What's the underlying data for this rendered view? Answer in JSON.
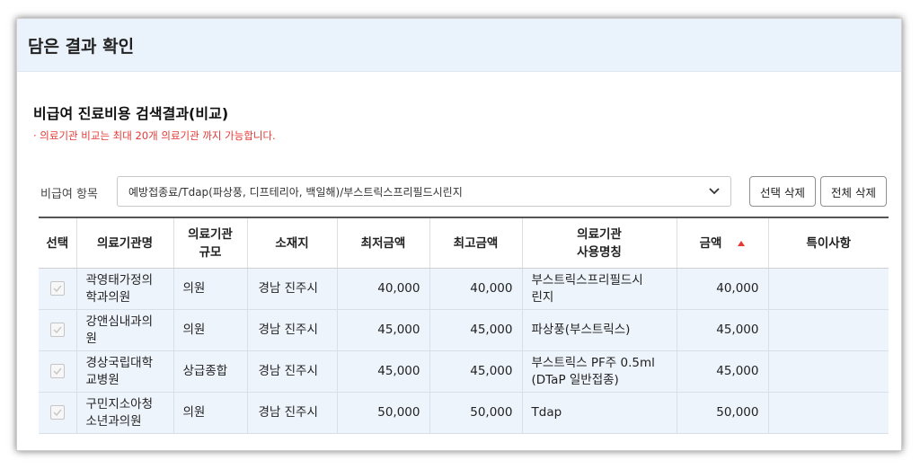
{
  "header": {
    "title": "담은 결과 확인"
  },
  "section": {
    "subtitle": "비급여 진료비용 검색결과(비교)",
    "notice": "· 의료기관 비교는 최대 20개 의료기관 까지 가능합니다."
  },
  "filter": {
    "label": "비급여 항목",
    "selected": "예방접종료/Tdap(파상풍, 디프테리아, 백일해)/부스트릭스프리필드시린지"
  },
  "buttons": {
    "delete_selected": "선택 삭제",
    "delete_all": "전체 삭제"
  },
  "table": {
    "headers": {
      "select": "선택",
      "name": "의료기관명",
      "scale_1": "의료기관",
      "scale_2": "규모",
      "location": "소재지",
      "min": "최저금액",
      "max": "최고금액",
      "usename_1": "의료기관",
      "usename_2": "사용명칭",
      "amount": "금액",
      "remark": "특이사항"
    },
    "sort_color": "#e53935",
    "rows": [
      {
        "name_1": "곽영태가정의",
        "name_2": "학과의원",
        "scale": "의원",
        "location": "경남 진주시",
        "min": "40,000",
        "max": "40,000",
        "use_1": "부스트릭스프리필드시",
        "use_2": "린지",
        "amount": "40,000",
        "remark": ""
      },
      {
        "name_1": "강앤심내과의",
        "name_2": "원",
        "scale": "의원",
        "location": "경남 진주시",
        "min": "45,000",
        "max": "45,000",
        "use_1": "파상풍(부스트릭스)",
        "use_2": "",
        "amount": "45,000",
        "remark": ""
      },
      {
        "name_1": "경상국립대학",
        "name_2": "교병원",
        "scale": "상급종합",
        "location": "경남 진주시",
        "min": "45,000",
        "max": "45,000",
        "use_1": "부스트릭스 PF주 0.5ml",
        "use_2": "(DTaP 일반접종)",
        "amount": "45,000",
        "remark": ""
      },
      {
        "name_1": "구민지소아청",
        "name_2": "소년과의원",
        "scale": "의원",
        "location": "경남 진주시",
        "min": "50,000",
        "max": "50,000",
        "use_1": "Tdap",
        "use_2": "",
        "amount": "50,000",
        "remark": ""
      }
    ]
  }
}
